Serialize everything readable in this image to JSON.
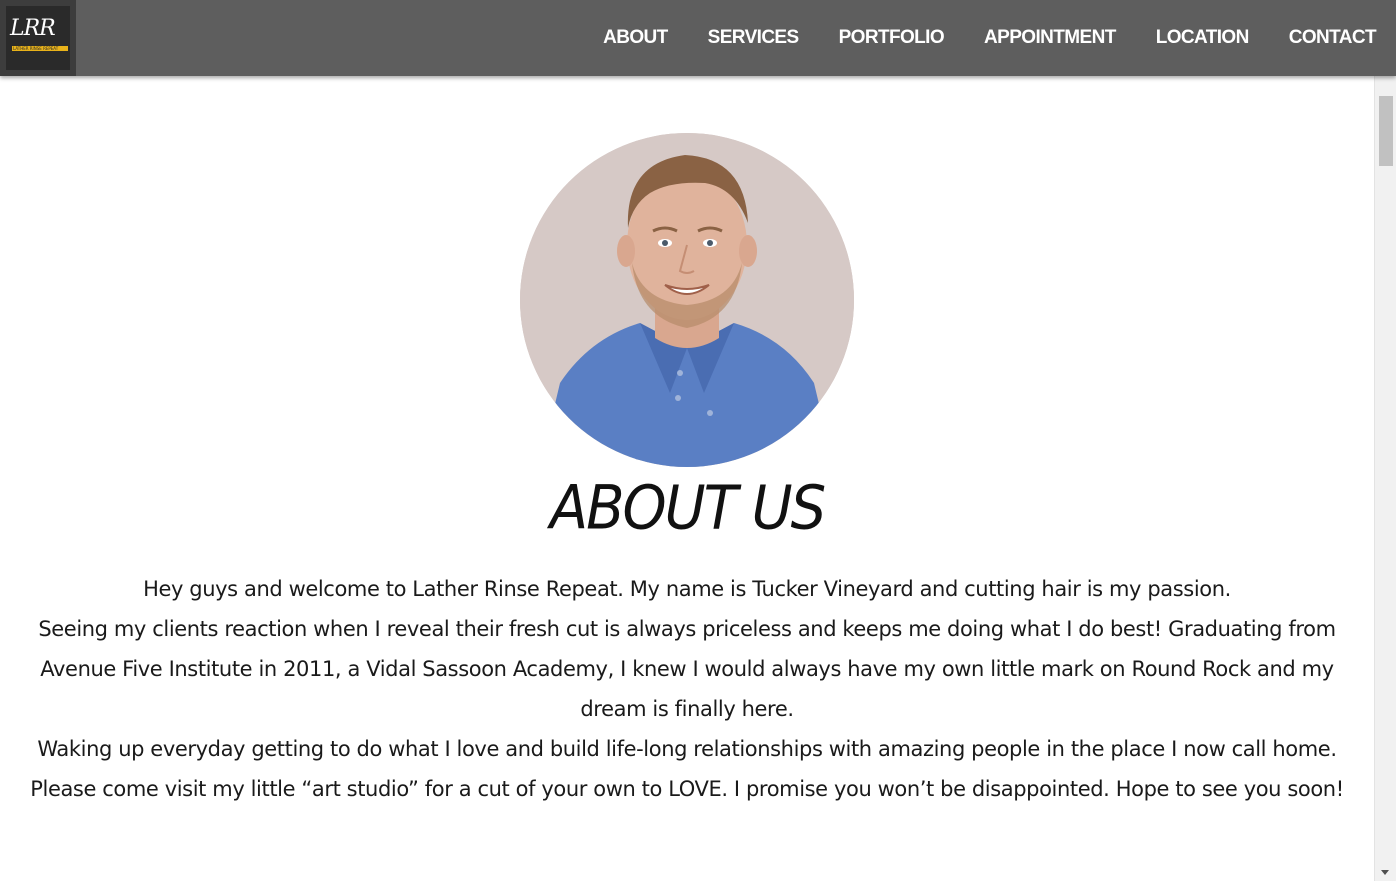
{
  "brand": {
    "logo_text": "LRR",
    "logo_tagline": "LATHER RINSE REPEAT"
  },
  "nav": {
    "items": [
      {
        "label": "ABOUT"
      },
      {
        "label": "SERVICES"
      },
      {
        "label": "PORTFOLIO"
      },
      {
        "label": "APPOINTMENT"
      },
      {
        "label": "LOCATION"
      },
      {
        "label": "CONTACT"
      }
    ]
  },
  "about": {
    "heading": "ABOUT US",
    "paragraphs": [
      "Hey guys and welcome to Lather Rinse Repeat. My name is Tucker Vineyard and cutting hair is my passion.",
      "Seeing my clients reaction when I reveal their fresh cut is always priceless and keeps me doing what I do best! Graduating from Avenue Five Institute in 2011, a Vidal Sassoon Academy, I knew I would always have my own little mark on Round Rock and my dream is finally here.",
      "Waking up everyday getting to do what I love and build life-long relationships with amazing people in the place I now call home.",
      "Please come visit my little “art studio” for a cut of your own to LOVE. I promise you won’t be disappointed. Hope to see you soon!"
    ]
  },
  "colors": {
    "navbar": "#5e5e5e",
    "logo_accent": "#e8b21a",
    "text": "#1a1a1a"
  }
}
